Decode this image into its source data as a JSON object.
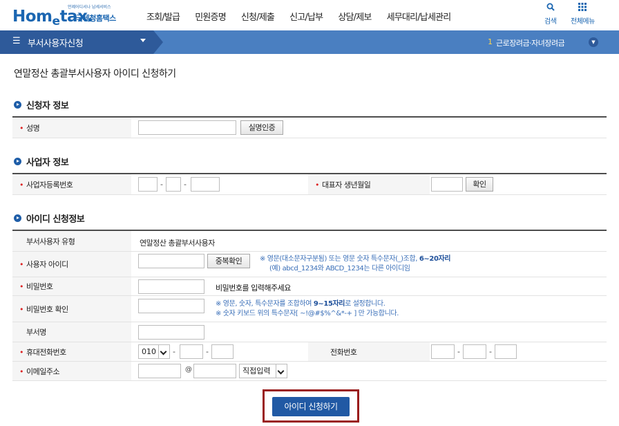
{
  "header": {
    "logo_small": "언제어디서나 납세서비스",
    "logo_main_a": "Hom",
    "logo_main_e": "e",
    "logo_main_b": "tax.",
    "logo_kr": "국세청홈택스",
    "nav": [
      "조회/발급",
      "민원증명",
      "신청/제출",
      "신고/납부",
      "상담/제보",
      "세무대리/납세관리"
    ],
    "search_label": "검색",
    "allmenu_label": "전체메뉴"
  },
  "subbar": {
    "title": "부서사용자신청",
    "notice_num": "1",
    "notice_text": "근로장려금·자녀장려금"
  },
  "page_title": "연말정산 총괄부서사용자 아이디 신청하기",
  "applicant": {
    "section_title": "신청자 정보",
    "name_label": "성명",
    "name_value": "",
    "verify_button": "실명인증"
  },
  "business": {
    "section_title": "사업자 정보",
    "brn_label": "사업자등록번호",
    "brn_values": [
      "",
      "",
      ""
    ],
    "dash": "-",
    "ceo_birth_label": "대표자 생년월일",
    "ceo_birth_value": "",
    "confirm_button": "확인"
  },
  "account": {
    "section_title": "아이디 신청정보",
    "dept_type_label": "부서사용자 유형",
    "dept_type_value": "연말정산 총괄부서사용자",
    "user_id_label": "사용자 아이디",
    "user_id_value": "",
    "dup_check_button": "중복확인",
    "id_note_1a": "※ 영문(대소문자구분됨) 또는 영문 숫자 특수문자(_)조합, ",
    "id_note_1b": "6~20자리",
    "id_note_2": "(예) abcd_1234와 ABCD_1234는 다른 아이디임",
    "password_label": "비밀번호",
    "password_value": "",
    "password_hint": "비밀번호를 입력해주세요",
    "password_confirm_label": "비밀번호 확인",
    "password_confirm_value": "",
    "pw_note_1a": "※ 영문, 숫자, 특수문자를 조합하여 ",
    "pw_note_1b": "9~15자리",
    "pw_note_1c": "로 설정합니다.",
    "pw_note_2": "※ 숫자 키보드 위의 특수문자[ ~!@#$%^&*-+ ] 만 가능합니다.",
    "dept_name_label": "부서명",
    "dept_name_value": "",
    "mobile_label": "휴대전화번호",
    "mobile_prefix": "010",
    "mobile_values": [
      "",
      ""
    ],
    "phone_label": "전화번호",
    "phone_values": [
      "",
      "",
      ""
    ],
    "email_label": "이메일주소",
    "email_id": "",
    "at": "@",
    "email_domain": "",
    "email_select": "직접입력"
  },
  "submit_button": "아이디 신청하기",
  "colors": {
    "brand_blue": "#1b66b1",
    "subbar_blue": "#4a7fc1",
    "subbar_dark": "#2e5a9a",
    "submit_blue": "#2159a4",
    "highlight_red": "#9a1b1b",
    "required_red": "#dd2222"
  }
}
